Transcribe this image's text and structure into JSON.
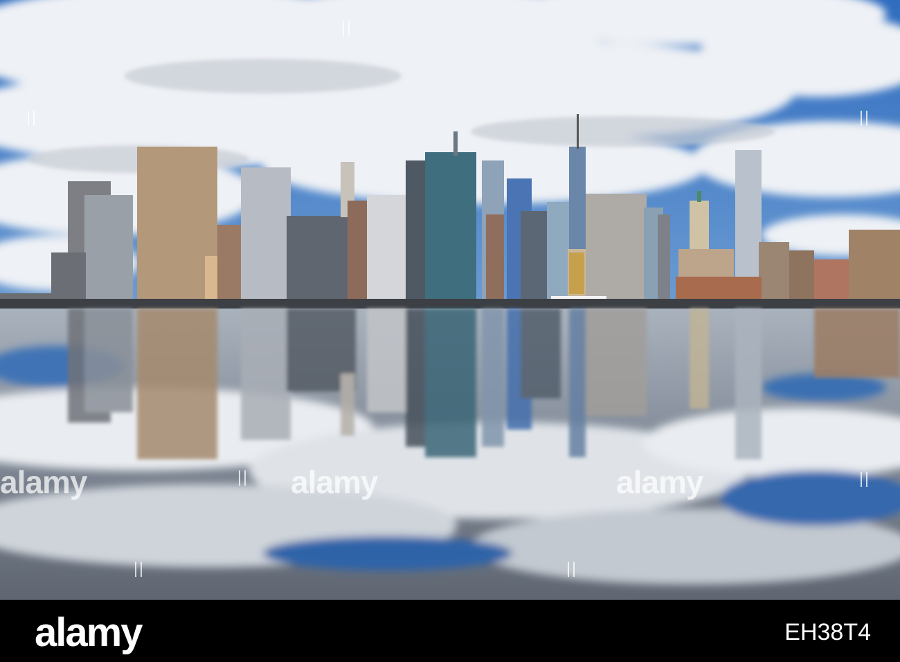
{
  "photo": {
    "subject": "skyline",
    "colors": {
      "sky": "#3b78c4",
      "cloud": "#f2f4f7",
      "water": "#8f98a4"
    }
  },
  "watermark": {
    "text": "alamy"
  },
  "footer": {
    "logo": "alamy",
    "image_id": "EH38T4"
  }
}
